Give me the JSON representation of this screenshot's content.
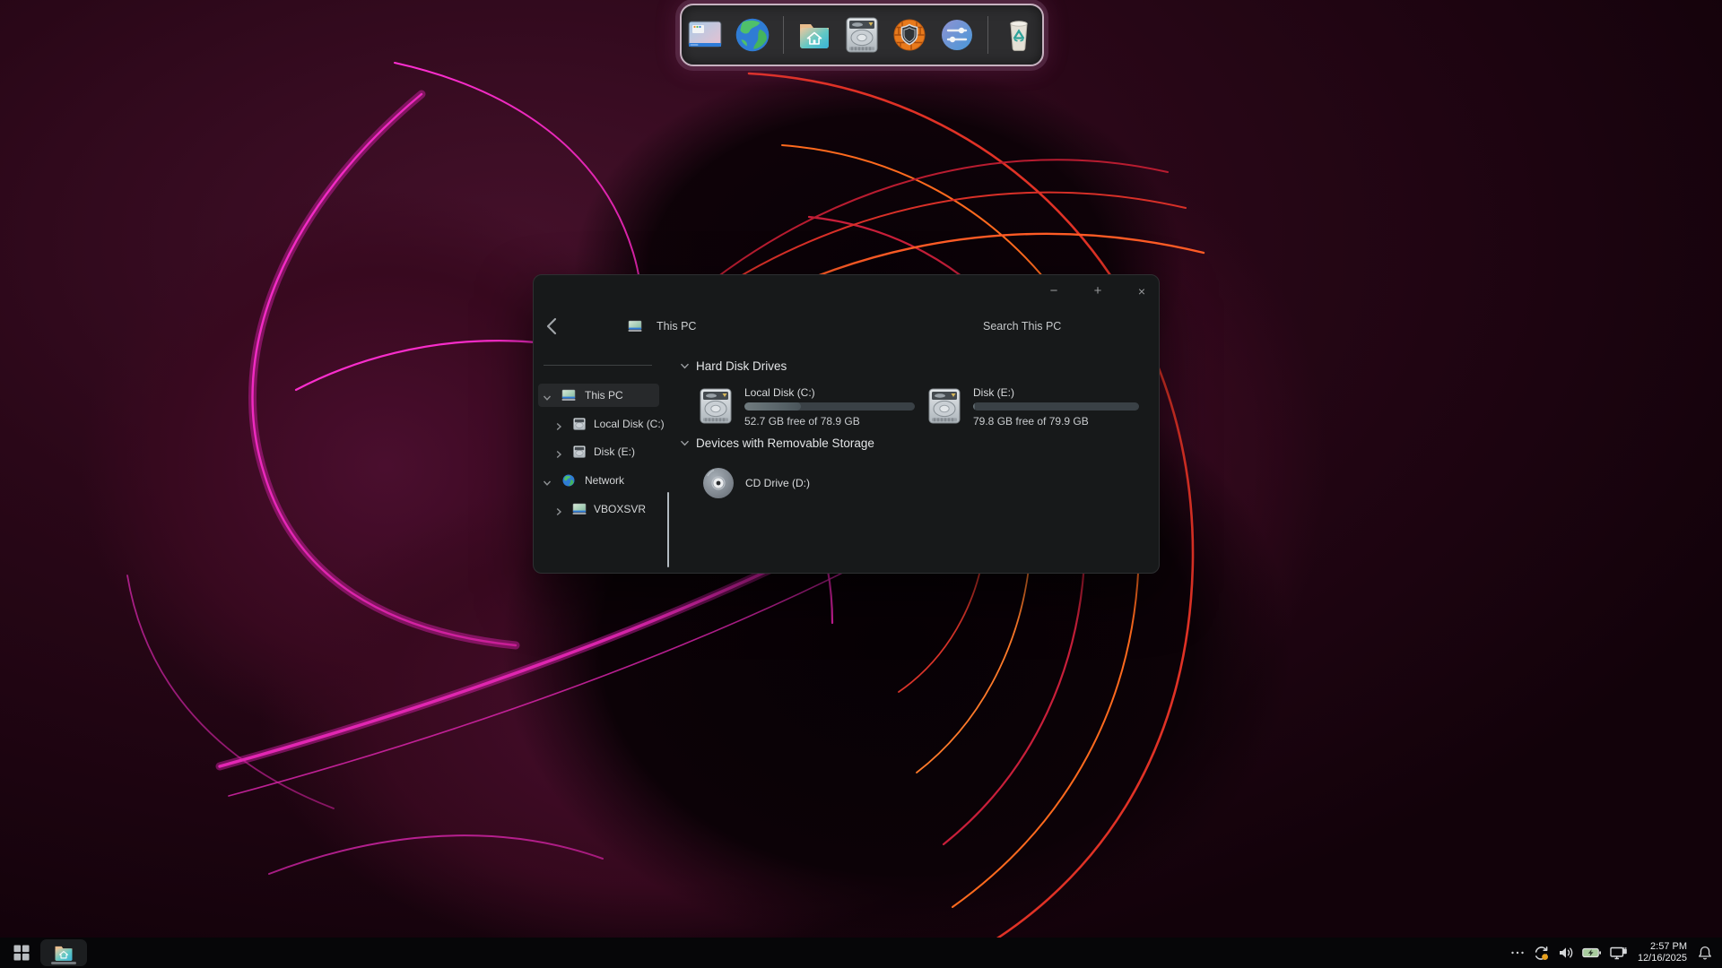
{
  "desktop": {
    "accent_colors": {
      "pink": "#ff2fd2",
      "red": "#e03226",
      "orange": "#ff6a1e"
    }
  },
  "dock": {
    "icons": [
      "desktop-icon",
      "web-browser-globe-icon",
      "file-manager-icon",
      "hard-disk-icon",
      "firewall-shield-icon",
      "settings-sliders-icon",
      "trash-icon"
    ]
  },
  "window": {
    "controls": {
      "minimize": "−",
      "maximize": "+",
      "close": "×"
    },
    "nav": {
      "breadcrumb": "This PC",
      "search_label": "Search This PC"
    },
    "sidebar": {
      "items": [
        {
          "label": "This PC"
        },
        {
          "label": "Local Disk (C:)"
        },
        {
          "label": "Disk (E:)"
        },
        {
          "label": "Network"
        },
        {
          "label": "VBOXSVR"
        }
      ]
    },
    "main": {
      "sections": [
        {
          "title": "Hard Disk Drives",
          "drives": [
            {
              "label": "Local Disk (C:)",
              "free_text": "52.7 GB free of 78.9 GB",
              "used_pct": 33
            },
            {
              "label": "Disk (E:)",
              "free_text": "79.8 GB free of 79.9 GB",
              "used_pct": 1
            }
          ]
        },
        {
          "title": "Devices with Removable Storage",
          "drives": [
            {
              "label": "CD Drive (D:)"
            }
          ]
        }
      ]
    }
  },
  "taskbar": {
    "tray": {
      "time": "2:57 PM",
      "date": "12/16/2025"
    }
  }
}
